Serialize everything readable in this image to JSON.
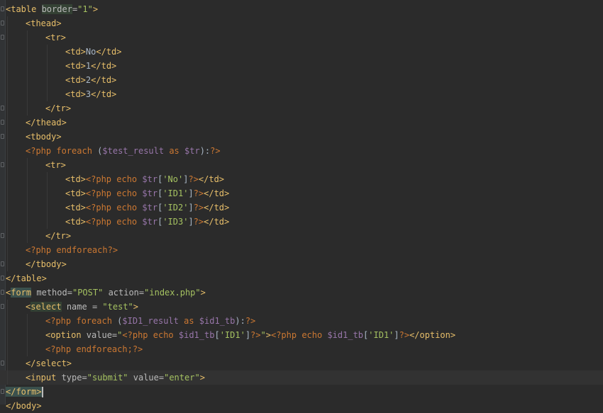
{
  "editor": {
    "language": "php-html",
    "current_line": 27,
    "colors": {
      "background": "#2b2b2b",
      "tag": "#e8bf6a",
      "attribute": "#bababa",
      "string": "#a5c261",
      "php_keyword": "#cc7832",
      "variable": "#9876aa",
      "text": "#a9b7c6"
    },
    "lines": [
      {
        "indent": 0,
        "fold": true,
        "tokens": [
          {
            "t": "<table ",
            "c": "tag"
          },
          {
            "t": "border",
            "c": "attr",
            "hl": true
          },
          {
            "t": "=",
            "c": "attr"
          },
          {
            "t": "\"1\"",
            "c": "str"
          },
          {
            "t": ">",
            "c": "tag"
          }
        ]
      },
      {
        "indent": 1,
        "fold": true,
        "tokens": [
          {
            "t": "<thead>",
            "c": "tag"
          }
        ]
      },
      {
        "indent": 2,
        "fold": true,
        "tokens": [
          {
            "t": "<tr>",
            "c": "tag"
          }
        ]
      },
      {
        "indent": 3,
        "fold": false,
        "tokens": [
          {
            "t": "<td>",
            "c": "tag"
          },
          {
            "t": "No",
            "c": "txt"
          },
          {
            "t": "</td>",
            "c": "tag"
          }
        ]
      },
      {
        "indent": 3,
        "fold": false,
        "tokens": [
          {
            "t": "<td>",
            "c": "tag"
          },
          {
            "t": "1",
            "c": "txt"
          },
          {
            "t": "</td>",
            "c": "tag"
          }
        ]
      },
      {
        "indent": 3,
        "fold": false,
        "tokens": [
          {
            "t": "<td>",
            "c": "tag"
          },
          {
            "t": "2",
            "c": "txt"
          },
          {
            "t": "</td>",
            "c": "tag"
          }
        ]
      },
      {
        "indent": 3,
        "fold": false,
        "tokens": [
          {
            "t": "<td>",
            "c": "tag"
          },
          {
            "t": "3",
            "c": "txt"
          },
          {
            "t": "</td>",
            "c": "tag"
          }
        ]
      },
      {
        "indent": 2,
        "fold": true,
        "tokens": [
          {
            "t": "</tr>",
            "c": "tag"
          }
        ]
      },
      {
        "indent": 1,
        "fold": true,
        "tokens": [
          {
            "t": "</thead>",
            "c": "tag"
          }
        ]
      },
      {
        "indent": 1,
        "fold": true,
        "tokens": [
          {
            "t": "<tbody>",
            "c": "tag"
          }
        ]
      },
      {
        "indent": 1,
        "fold": false,
        "tokens": [
          {
            "t": "<?php foreach ",
            "c": "php"
          },
          {
            "t": "(",
            "c": "txt"
          },
          {
            "t": "$test_result",
            "c": "var"
          },
          {
            "t": " as ",
            "c": "php"
          },
          {
            "t": "$tr",
            "c": "var"
          },
          {
            "t": "):",
            "c": "txt"
          },
          {
            "t": "?>",
            "c": "php"
          }
        ]
      },
      {
        "indent": 2,
        "fold": true,
        "tokens": [
          {
            "t": "<tr>",
            "c": "tag"
          }
        ]
      },
      {
        "indent": 3,
        "fold": false,
        "tokens": [
          {
            "t": "<td>",
            "c": "tag"
          },
          {
            "t": "<?php echo ",
            "c": "php"
          },
          {
            "t": "$tr",
            "c": "var"
          },
          {
            "t": "[",
            "c": "txt"
          },
          {
            "t": "'No'",
            "c": "str"
          },
          {
            "t": "]",
            "c": "txt"
          },
          {
            "t": "?>",
            "c": "php"
          },
          {
            "t": "</td>",
            "c": "tag"
          }
        ]
      },
      {
        "indent": 3,
        "fold": false,
        "tokens": [
          {
            "t": "<td>",
            "c": "tag"
          },
          {
            "t": "<?php echo ",
            "c": "php"
          },
          {
            "t": "$tr",
            "c": "var"
          },
          {
            "t": "[",
            "c": "txt"
          },
          {
            "t": "'ID1'",
            "c": "str"
          },
          {
            "t": "]",
            "c": "txt"
          },
          {
            "t": "?>",
            "c": "php"
          },
          {
            "t": "</td>",
            "c": "tag"
          }
        ]
      },
      {
        "indent": 3,
        "fold": false,
        "tokens": [
          {
            "t": "<td>",
            "c": "tag"
          },
          {
            "t": "<?php echo ",
            "c": "php"
          },
          {
            "t": "$tr",
            "c": "var"
          },
          {
            "t": "[",
            "c": "txt"
          },
          {
            "t": "'ID2'",
            "c": "str"
          },
          {
            "t": "]",
            "c": "txt"
          },
          {
            "t": "?>",
            "c": "php"
          },
          {
            "t": "</td>",
            "c": "tag"
          }
        ]
      },
      {
        "indent": 3,
        "fold": false,
        "tokens": [
          {
            "t": "<td>",
            "c": "tag"
          },
          {
            "t": "<?php echo ",
            "c": "php"
          },
          {
            "t": "$tr",
            "c": "var"
          },
          {
            "t": "[",
            "c": "txt"
          },
          {
            "t": "'ID3'",
            "c": "str"
          },
          {
            "t": "]",
            "c": "txt"
          },
          {
            "t": "?>",
            "c": "php"
          },
          {
            "t": "</td>",
            "c": "tag"
          }
        ]
      },
      {
        "indent": 2,
        "fold": true,
        "tokens": [
          {
            "t": "</tr>",
            "c": "tag"
          }
        ]
      },
      {
        "indent": 1,
        "fold": false,
        "tokens": [
          {
            "t": "<?php endforeach",
            "c": "php"
          },
          {
            "t": "?>",
            "c": "php"
          }
        ]
      },
      {
        "indent": 1,
        "fold": true,
        "tokens": [
          {
            "t": "</tbody>",
            "c": "tag"
          }
        ]
      },
      {
        "indent": 0,
        "fold": true,
        "tokens": [
          {
            "t": "</table>",
            "c": "tag"
          }
        ]
      },
      {
        "indent": 0,
        "fold": true,
        "tokens": [
          {
            "t": "<",
            "c": "tag"
          },
          {
            "t": "form",
            "c": "tag",
            "hl2": true
          },
          {
            "t": " ",
            "c": "tag"
          },
          {
            "t": "method",
            "c": "attr"
          },
          {
            "t": "=",
            "c": "attr"
          },
          {
            "t": "\"POST\"",
            "c": "str"
          },
          {
            "t": " ",
            "c": "attr"
          },
          {
            "t": "action",
            "c": "attr"
          },
          {
            "t": "=",
            "c": "attr"
          },
          {
            "t": "\"index.php\"",
            "c": "str"
          },
          {
            "t": ">",
            "c": "tag"
          }
        ]
      },
      {
        "indent": 1,
        "fold": true,
        "tokens": [
          {
            "t": "<",
            "c": "tag"
          },
          {
            "t": "select",
            "c": "tag",
            "hl": true
          },
          {
            "t": " ",
            "c": "tag"
          },
          {
            "t": "name",
            "c": "attr"
          },
          {
            "t": " = ",
            "c": "attr"
          },
          {
            "t": "\"test\"",
            "c": "str"
          },
          {
            "t": ">",
            "c": "tag"
          }
        ]
      },
      {
        "indent": 2,
        "fold": false,
        "tokens": [
          {
            "t": "<?php foreach ",
            "c": "php"
          },
          {
            "t": "(",
            "c": "txt"
          },
          {
            "t": "$ID1_result",
            "c": "var"
          },
          {
            "t": " as ",
            "c": "php"
          },
          {
            "t": "$id1_tb",
            "c": "var"
          },
          {
            "t": "):",
            "c": "txt"
          },
          {
            "t": "?>",
            "c": "php"
          }
        ]
      },
      {
        "indent": 2,
        "fold": false,
        "tokens": [
          {
            "t": "<option ",
            "c": "tag"
          },
          {
            "t": "value",
            "c": "attr"
          },
          {
            "t": "=",
            "c": "attr"
          },
          {
            "t": "\"",
            "c": "str"
          },
          {
            "t": "<?php echo ",
            "c": "php"
          },
          {
            "t": "$id1_tb",
            "c": "var"
          },
          {
            "t": "[",
            "c": "txt"
          },
          {
            "t": "'ID1'",
            "c": "str"
          },
          {
            "t": "]",
            "c": "txt"
          },
          {
            "t": "?>",
            "c": "php"
          },
          {
            "t": "\"",
            "c": "str"
          },
          {
            "t": ">",
            "c": "tag"
          },
          {
            "t": "<?php echo ",
            "c": "php"
          },
          {
            "t": "$id1_tb",
            "c": "var"
          },
          {
            "t": "[",
            "c": "txt"
          },
          {
            "t": "'ID1'",
            "c": "str"
          },
          {
            "t": "]",
            "c": "txt"
          },
          {
            "t": "?>",
            "c": "php"
          },
          {
            "t": "</option>",
            "c": "tag"
          }
        ]
      },
      {
        "indent": 2,
        "fold": false,
        "tokens": [
          {
            "t": "<?php endforeach;",
            "c": "php"
          },
          {
            "t": "?>",
            "c": "php"
          }
        ]
      },
      {
        "indent": 1,
        "fold": true,
        "tokens": [
          {
            "t": "</select>",
            "c": "tag"
          }
        ]
      },
      {
        "indent": 1,
        "fold": false,
        "tokens": [
          {
            "t": "<input ",
            "c": "tag"
          },
          {
            "t": "type",
            "c": "attr"
          },
          {
            "t": "=",
            "c": "attr"
          },
          {
            "t": "\"submit\"",
            "c": "str"
          },
          {
            "t": " ",
            "c": "attr"
          },
          {
            "t": "value",
            "c": "attr"
          },
          {
            "t": "=",
            "c": "attr"
          },
          {
            "t": "\"enter\"",
            "c": "str"
          },
          {
            "t": ">",
            "c": "tag"
          }
        ]
      },
      {
        "indent": 0,
        "fold": true,
        "caret": true,
        "tokens": [
          {
            "t": "</",
            "c": "tag",
            "hl2": true
          },
          {
            "t": "form",
            "c": "tag",
            "hl2": true
          },
          {
            "t": ">",
            "c": "tag",
            "hl2": true
          }
        ]
      },
      {
        "indent": 0,
        "fold": false,
        "tokens": [
          {
            "t": "</body>",
            "c": "tag"
          }
        ]
      }
    ]
  }
}
